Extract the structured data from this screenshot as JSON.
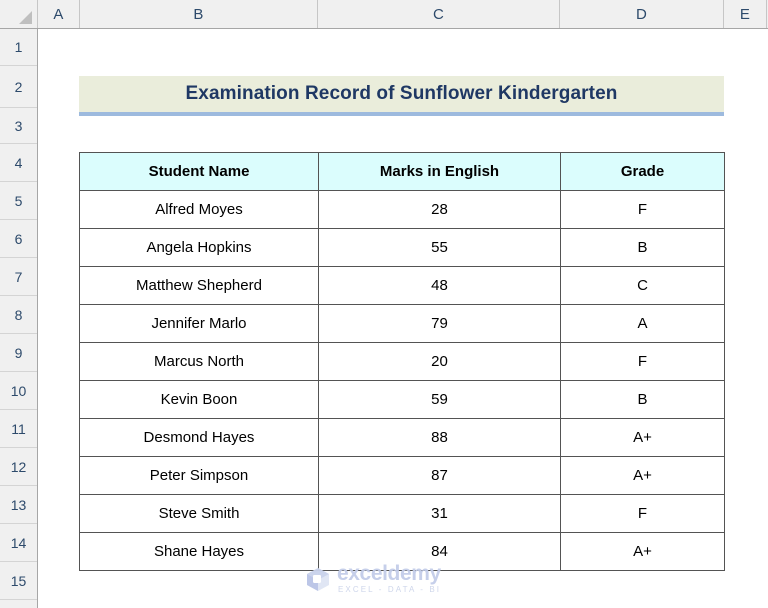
{
  "app": {
    "type": "spreadsheet",
    "select_all_icon": "select-all-triangle-icon"
  },
  "grid": {
    "column_headers": [
      "A",
      "B",
      "C",
      "D",
      "E"
    ],
    "row_headers": [
      "1",
      "2",
      "3",
      "4",
      "5",
      "6",
      "7",
      "8",
      "9",
      "10",
      "11",
      "12",
      "13",
      "14",
      "15"
    ]
  },
  "title": {
    "text": "Examination Record of Sunflower Kindergarten",
    "background_color": "#eaeddb",
    "text_color": "#1f3864",
    "underline_color": "#9dbade"
  },
  "table": {
    "header_background_color": "#dbfdfd",
    "border_color": "#535353",
    "columns": [
      "Student Name",
      "Marks in English",
      "Grade"
    ],
    "rows": [
      {
        "name": "Alfred Moyes",
        "marks": "28",
        "grade": "F"
      },
      {
        "name": "Angela Hopkins",
        "marks": "55",
        "grade": "B"
      },
      {
        "name": "Matthew Shepherd",
        "marks": "48",
        "grade": "C"
      },
      {
        "name": "Jennifer Marlo",
        "marks": "79",
        "grade": "A"
      },
      {
        "name": "Marcus North",
        "marks": "20",
        "grade": "F"
      },
      {
        "name": "Kevin Boon",
        "marks": "59",
        "grade": "B"
      },
      {
        "name": "Desmond Hayes",
        "marks": "88",
        "grade": "A+"
      },
      {
        "name": "Peter Simpson",
        "marks": "87",
        "grade": "A+"
      },
      {
        "name": "Steve Smith",
        "marks": "31",
        "grade": "F"
      },
      {
        "name": "Shane Hayes",
        "marks": "84",
        "grade": "A+"
      }
    ]
  },
  "watermark": {
    "name": "exceldemy",
    "tagline": "EXCEL - DATA - BI",
    "icon": "cube-logo-icon",
    "color": "#c3cde9"
  }
}
